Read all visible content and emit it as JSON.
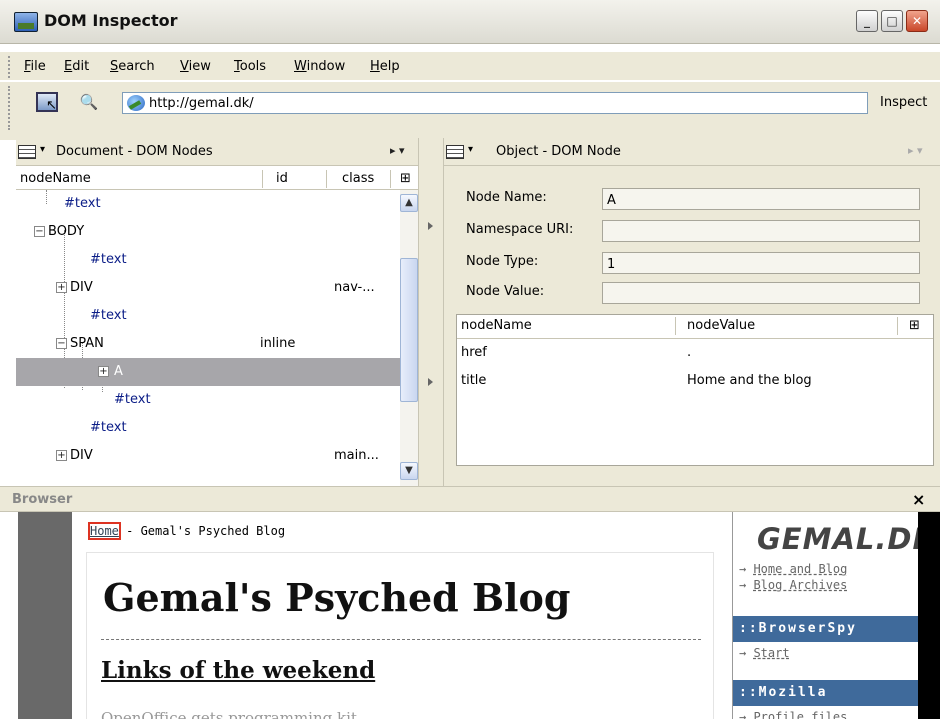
{
  "window": {
    "title": "DOM Inspector",
    "min_glyph": "_",
    "max_glyph": "□",
    "close_glyph": "✕"
  },
  "menu": [
    {
      "label": "File",
      "accel": "F",
      "rest": "ile"
    },
    {
      "label": "Edit",
      "accel": "E",
      "rest": "dit"
    },
    {
      "label": "Search",
      "accel": "S",
      "rest": "earch"
    },
    {
      "label": "View",
      "accel": "V",
      "rest": "iew"
    },
    {
      "label": "Tools",
      "accel": "T",
      "rest": "ools"
    },
    {
      "label": "Window",
      "accel": "W",
      "rest": "indow"
    },
    {
      "label": "Help",
      "accel": "H",
      "rest": "elp"
    }
  ],
  "toolbar": {
    "url": "http://gemal.dk/",
    "inspect_label": "Inspect",
    "find_glyph": "🔍"
  },
  "left_panel": {
    "title": "Document - DOM Nodes",
    "dropdown_glyph": "▾",
    "menu_glyph": "▸ ▾",
    "columns": [
      "nodeName",
      "id",
      "class"
    ],
    "picker_glyph": "⊞",
    "nodes": [
      {
        "name": "#text",
        "type": "text",
        "id": "",
        "class": "",
        "selected": false
      },
      {
        "name": "BODY",
        "type": "element",
        "toggle": "−",
        "id": "",
        "class": "",
        "selected": false
      },
      {
        "name": "#text",
        "type": "text",
        "id": "",
        "class": "",
        "selected": false
      },
      {
        "name": "DIV",
        "type": "element",
        "toggle": "+",
        "id": "",
        "class": "nav-...",
        "selected": false
      },
      {
        "name": "#text",
        "type": "text",
        "id": "",
        "class": "",
        "selected": false
      },
      {
        "name": "SPAN",
        "type": "element",
        "toggle": "−",
        "id": "inline",
        "class": "",
        "selected": false
      },
      {
        "name": "A",
        "type": "element",
        "toggle": "+",
        "id": "",
        "class": "",
        "selected": true
      },
      {
        "name": "#text",
        "type": "text",
        "id": "",
        "class": "",
        "selected": false
      },
      {
        "name": "#text",
        "type": "text",
        "id": "",
        "class": "",
        "selected": false
      },
      {
        "name": "DIV",
        "type": "element",
        "toggle": "+",
        "id": "",
        "class": "main...",
        "selected": false
      }
    ],
    "scroll_up": "▲",
    "scroll_down": "▼"
  },
  "right_panel": {
    "title": "Object - DOM Node",
    "dropdown_glyph": "▾",
    "menu_glyph": "▸ ▾",
    "fields": {
      "node_name": {
        "label": "Node Name:",
        "value": "A"
      },
      "namespace_uri": {
        "label": "Namespace URI:",
        "value": ""
      },
      "node_type": {
        "label": "Node Type:",
        "value": "1"
      },
      "node_value": {
        "label": "Node Value:",
        "value": ""
      }
    },
    "attr_columns": [
      "nodeName",
      "nodeValue"
    ],
    "picker_glyph": "⊞",
    "attributes": [
      {
        "name": "href",
        "value": "."
      },
      {
        "name": "title",
        "value": "Home and the blog"
      }
    ]
  },
  "browser": {
    "title": "Browser",
    "close_glyph": "×",
    "page": {
      "crumb_home": "Home",
      "crumb_rest": " - Gemal's Psyched Blog",
      "site_title": "Gemal's Psyched Blog",
      "post_title": "Links of the weekend",
      "excerpt": "OpenOffice gets programming kit"
    },
    "sidebar": {
      "logo": "GEMAL.DK",
      "links": [
        "Home and Blog",
        "Blog Archives"
      ],
      "sections": [
        {
          "title": "::BrowserSpy",
          "links": [
            "Start"
          ]
        },
        {
          "title": "::Mozilla",
          "links": [
            "Profile files"
          ]
        }
      ]
    }
  },
  "colors": {
    "text_node": "#0b1d87",
    "selection": "#a7a6aa",
    "chrome": "#ece9d8",
    "sidebar_header": "#3f6a9b",
    "highlight_box": "#dd3322"
  }
}
